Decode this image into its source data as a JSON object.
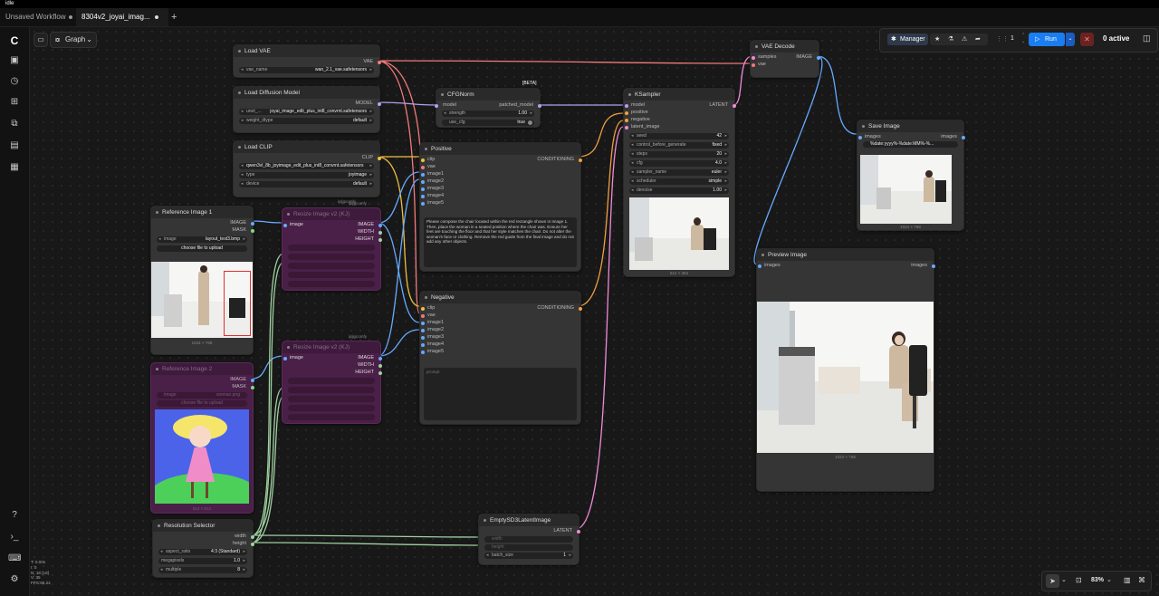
{
  "app": {
    "title": "idle"
  },
  "tabs": [
    {
      "label": "Unsaved Workflow"
    },
    {
      "label": "8304v2_joyai_imag..."
    }
  ],
  "tab_add": "+",
  "toolbar": {
    "graph_label": "Graph",
    "manager_label": "Manager",
    "queue_count": "1",
    "run_label": "Run",
    "active_label": "0 active"
  },
  "stats": [
    "T: 0.00s",
    "I: 0",
    "N: 18 [18]",
    "V: 35",
    "FPS:65.24"
  ],
  "zoom": {
    "value": "83%"
  },
  "nodes": {
    "load_vae": {
      "title": "Load VAE",
      "out": "VAE",
      "w_name": "vae_name",
      "w_val": "wan_2.1_vae.safetensors"
    },
    "load_diffusion": {
      "title": "Load Diffusion Model",
      "out": "MODEL",
      "w1_name": "unet_...",
      "w1_val": "joyai_image_edit_plus_int8_convrnt.safetensors",
      "w2_name": "weight_dtype",
      "w2_val": "default"
    },
    "load_clip": {
      "title": "Load CLIP",
      "out": "CLIP",
      "w1_name": "clip_name",
      "w1_val": "qwen3vl_8b_joyimage_edit_plus_int8_convrnt.safetensors",
      "w2_name": "type",
      "w2_val": "joyimage",
      "w3_name": "device",
      "w3_val": "default",
      "footer": "ipljgcomfy"
    },
    "cfgnorm": {
      "title": "CFGNorm",
      "badge": "[BETA]",
      "in": "model",
      "out": "patched_model",
      "w1_name": "strength",
      "w1_val": "1.00",
      "w2_name": "use_cfg",
      "w2_val": "true"
    },
    "positive": {
      "title": "Positive",
      "inputs": [
        "clip",
        "vae",
        "image1",
        "image2",
        "image3",
        "image4",
        "image5"
      ],
      "out": "CONDITIONING",
      "prompt": "Please compose the chair located within the red rectangle shown in Image 1. Then, place the woman in a seated position where the chair was. Ensure her feet are touching the floor and that her style matches the chair. Do not alter the woman's face or clothing. Remove the red guide from the final image and do not add any other objects."
    },
    "negative": {
      "title": "Negative",
      "inputs": [
        "clip",
        "vae",
        "image1",
        "image2",
        "image3",
        "image4",
        "image5"
      ],
      "out": "CONDITIONING",
      "prompt": "prompt"
    },
    "ksampler": {
      "title": "KSampler",
      "inputs": [
        "model",
        "positive",
        "negative",
        "latent_image"
      ],
      "out": "LATENT",
      "widgets": [
        {
          "name": "seed",
          "value": "42"
        },
        {
          "name": "control_before_generate",
          "value": "fixed"
        },
        {
          "name": "steps",
          "value": "20"
        },
        {
          "name": "cfg",
          "value": "4.0"
        },
        {
          "name": "sampler_name",
          "value": "euler"
        },
        {
          "name": "scheduler",
          "value": "simple"
        },
        {
          "name": "denoise",
          "value": "1.00"
        }
      ],
      "caption": "512 × 384"
    },
    "vae_decode": {
      "title": "VAE Decode",
      "in1": "samples",
      "in2": "vae",
      "out": "IMAGE"
    },
    "save_image": {
      "title": "Save Image",
      "in": "images",
      "out": "images",
      "w_val": "%date:yyyy%-%date:MM%-%...",
      "caption": "1024 × 768"
    },
    "preview_image": {
      "title": "Preview Image",
      "in": "images",
      "out": "images",
      "caption": "1024 × 768"
    },
    "reference_image": {
      "title": "Reference Image 1",
      "out1": "IMAGE",
      "out2": "MASK",
      "w_name": "image",
      "w_val": "layout_test3.bmp",
      "upload": "choose file to upload",
      "caption": "1024 × 768"
    },
    "reference_image_2": {
      "title": "Reference Image 2",
      "out1": "IMAGE",
      "out2": "MASK",
      "w_name": "image",
      "w_val": "woman.png",
      "upload": "choose file to upload",
      "caption": "512 × 512"
    },
    "resize_1": {
      "title": "Resize Image v2 (KJ)",
      "in": "image",
      "out1": "IMAGE",
      "out2": "WIDTH",
      "out3": "HEIGHT",
      "footer": "ipljgcomfy"
    },
    "resize_2": {
      "title": "Resize Image v2 (KJ)",
      "in": "image",
      "out1": "IMAGE",
      "out2": "WIDTH",
      "out3": "HEIGHT",
      "footer": "ipljgcomfy"
    },
    "resolution": {
      "title": "Resolution Selector",
      "out1": "width",
      "out2": "height",
      "widgets": [
        {
          "name": "aspect_ratio",
          "value": "4:3 (Standard)"
        },
        {
          "name": "megapixels",
          "value": "1.0"
        },
        {
          "name": "multiple",
          "value": "8"
        }
      ]
    },
    "latent": {
      "title": "EmptySD3LatentImage",
      "out": "LATENT",
      "w1": "width",
      "w2": "height",
      "w3_name": "batch_size",
      "w3_val": "1"
    }
  },
  "colors": {
    "vae": "#f27a7a",
    "model": "#b4a0ec",
    "clip": "#f0c040",
    "image": "#66aaff",
    "latent": "#f08ad8",
    "conditioning": "#f0a040",
    "int": "#9fd0a0",
    "run": "#1a7ef2"
  }
}
